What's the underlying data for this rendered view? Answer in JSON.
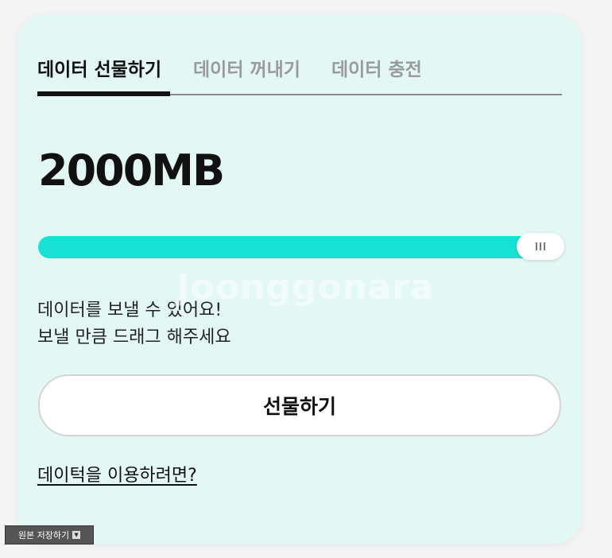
{
  "tabs": [
    {
      "label": "데이터 선물하기",
      "active": true
    },
    {
      "label": "데이터 꺼내기",
      "active": false
    },
    {
      "label": "데이터 충전",
      "active": false
    }
  ],
  "amount": "2000MB",
  "slider": {
    "fill_fraction": 0.97
  },
  "description": {
    "line1": "데이터를 보낼 수 있어요!",
    "line2": "보낼 만큼 드래그 해주세요"
  },
  "gift_button_label": "선물하기",
  "help_link_label": "데이턱을 이용하려면?",
  "watermark": "Joonggonara",
  "save_button_label": "원본 저장하기",
  "colors": {
    "background": "#e3f7f5",
    "accent": "#16e1d3",
    "text": "#111111"
  }
}
